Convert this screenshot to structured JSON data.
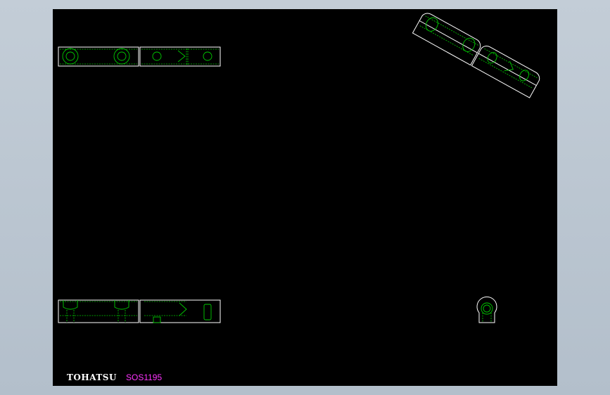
{
  "drawing": {
    "brand_label": "TOHATSU",
    "part_number": "SOS1195",
    "colors": {
      "background": "#000000",
      "outline": "#ffffff",
      "hidden": "#00cc00",
      "label": "#ff33ff"
    }
  }
}
